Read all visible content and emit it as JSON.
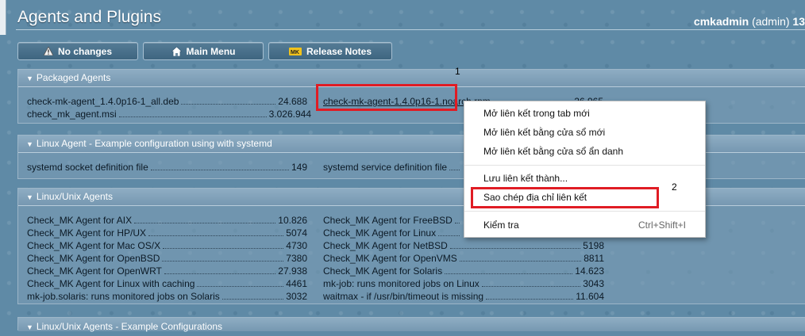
{
  "header": {
    "title": "Agents and Plugins",
    "user": "cmkadmin",
    "role": "(admin)",
    "extra": "13"
  },
  "toolbar": {
    "no_changes": "No changes",
    "main_menu": "Main Menu",
    "release_notes": "Release Notes"
  },
  "packaged": {
    "title": "Packaged Agents",
    "files": [
      {
        "name": "check-mk-agent_1.4.0p16-1_all.deb",
        "size": "24.688"
      },
      {
        "name": "check_mk_agent.msi",
        "size": "3.026.944"
      },
      {
        "name": "check-mk-agent-1.4.0p16-1.noarch.rpm",
        "size": "26.965"
      }
    ]
  },
  "systemd": {
    "title": "Linux Agent - Example configuration using with systemd",
    "files": [
      {
        "name": "systemd socket definition file",
        "size": "149"
      },
      {
        "name": "systemd service definition file",
        "size": ""
      }
    ]
  },
  "unix": {
    "title": "Linux/Unix Agents",
    "left": [
      {
        "name": "Check_MK Agent for AIX",
        "size": "10.826"
      },
      {
        "name": "Check_MK Agent for HP/UX",
        "size": "5074"
      },
      {
        "name": "Check_MK Agent for Mac OS/X",
        "size": "4730"
      },
      {
        "name": "Check_MK Agent for OpenBSD",
        "size": "7380"
      },
      {
        "name": "Check_MK Agent for OpenWRT",
        "size": "27.938"
      },
      {
        "name": "Check_MK Agent for Linux with caching",
        "size": "4461"
      },
      {
        "name": "mk-job.solaris: runs monitored jobs on Solaris",
        "size": "3032"
      }
    ],
    "right": [
      {
        "name": "Check_MK Agent for FreeBSD",
        "size": ""
      },
      {
        "name": "Check_MK Agent for Linux",
        "size": ""
      },
      {
        "name": "Check_MK Agent for NetBSD",
        "size": "5198"
      },
      {
        "name": "Check_MK Agent for OpenVMS",
        "size": "8811"
      },
      {
        "name": "Check_MK Agent for Solaris",
        "size": "14.623"
      },
      {
        "name": "mk-job: runs monitored jobs on Linux",
        "size": "3043"
      },
      {
        "name": "waitmax - if /usr/bin/timeout is missing",
        "size": "11.604"
      }
    ]
  },
  "examples": {
    "title": "Linux/Unix Agents - Example Configurations"
  },
  "context_menu": {
    "open_new_tab": "Mở liên kết trong tab mới",
    "open_new_window": "Mở liên kết bằng cửa sổ mới",
    "open_incognito": "Mở liên kết bằng cửa sổ ẩn danh",
    "save_link": "Lưu liên kết thành...",
    "copy_link": "Sao chép địa chỉ liên kết",
    "inspect": "Kiểm tra",
    "inspect_shortcut": "Ctrl+Shift+I"
  },
  "annotations": {
    "step1": "1",
    "step2": "2",
    "highlight_color": "#e01c24"
  },
  "icons": [
    "warning-icon",
    "home-icon",
    "mk-logo-icon",
    "collapse-triangle-icon"
  ]
}
